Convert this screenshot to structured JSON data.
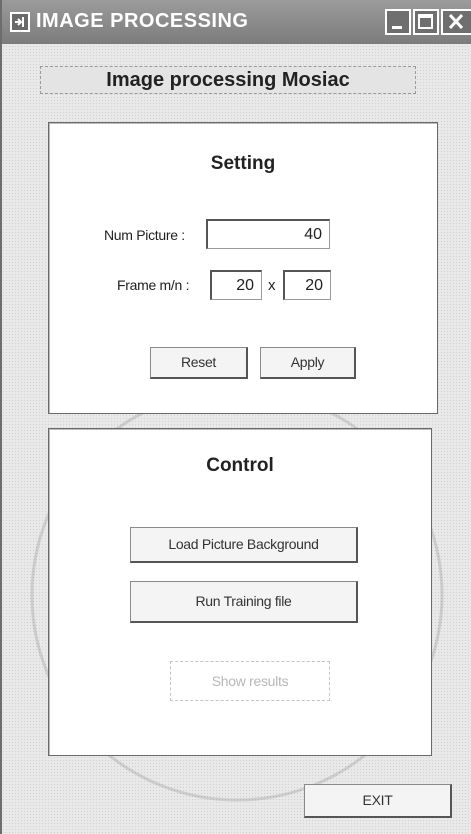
{
  "window": {
    "title": "IMAGE PROCESSING",
    "icons": {
      "app": "app-icon",
      "minimize": "minimize-icon",
      "maximize": "maximize-icon",
      "close": "close-icon"
    }
  },
  "header": {
    "title": "Image processing Mosiac"
  },
  "setting": {
    "title": "Setting",
    "num_picture_label": "Num Picture :",
    "num_picture_value": "40",
    "frame_label": "Frame m/n :",
    "frame_m_value": "20",
    "frame_separator": "x",
    "frame_n_value": "20",
    "reset_label": "Reset",
    "apply_label": "Apply"
  },
  "control": {
    "title": "Control",
    "load_background_label": "Load Picture Background",
    "run_training_label": "Run Training file",
    "show_results_label": "Show results"
  },
  "footer": {
    "exit_label": "EXIT"
  }
}
